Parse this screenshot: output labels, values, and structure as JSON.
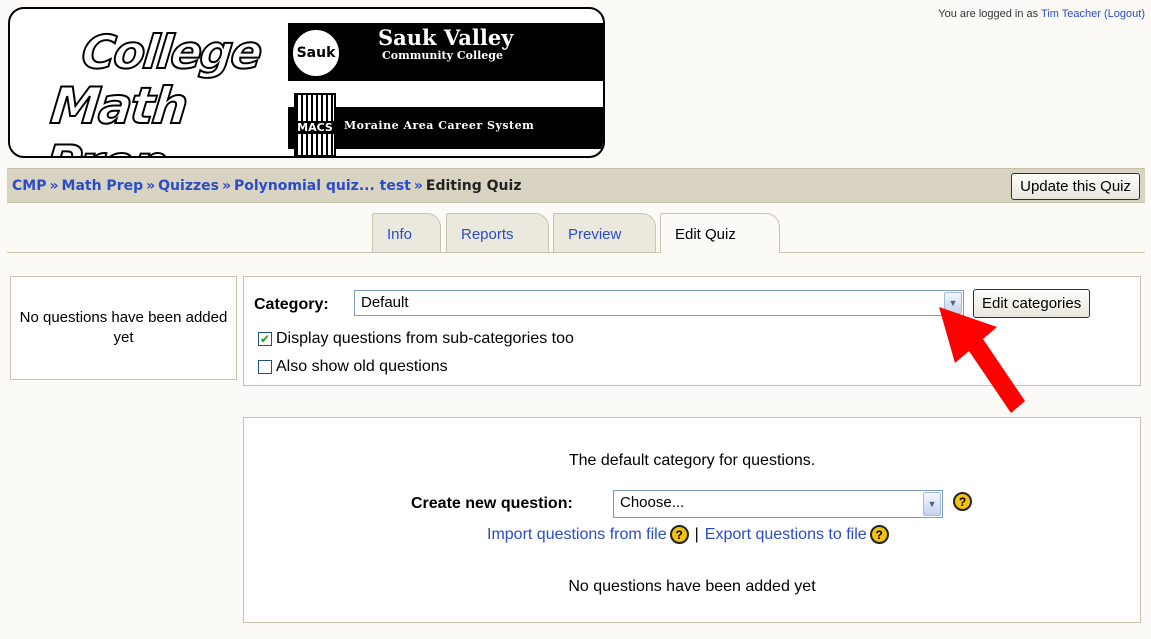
{
  "login": {
    "prefix": "You are logged in as ",
    "user": "Tim Teacher",
    "logout": "(Logout)"
  },
  "logo": {
    "line1": "College",
    "line2": "Math Prep",
    "sauk_circle": "Sauk",
    "sauk_title": "Sauk Valley",
    "sauk_subtitle": "Community College",
    "macs_short": "MACS",
    "macs_full": "Moraine Area Career System"
  },
  "breadcrumb": {
    "items": [
      "CMP",
      "Math Prep",
      "Quizzes",
      "Polynomial quiz... test"
    ],
    "separator": "»",
    "current": "Editing Quiz"
  },
  "update_button": "Update this Quiz",
  "tabs": [
    {
      "label": "Info"
    },
    {
      "label": "Reports"
    },
    {
      "label": "Preview"
    },
    {
      "label": "Edit Quiz"
    }
  ],
  "left_panel": {
    "text": "No questions have been added yet"
  },
  "category": {
    "label": "Category:",
    "selected": "Default",
    "edit_button": "Edit categories",
    "subcat_checkbox": {
      "label": "Display questions from sub-categories too",
      "checked": true
    },
    "old_checkbox": {
      "label": "Also show old questions",
      "checked": false
    }
  },
  "main": {
    "category_description": "The default category for questions.",
    "create_label": "Create new question:",
    "create_selected": "Choose...",
    "import_link": "Import questions from file",
    "pipe": "|",
    "export_link": "Export questions to file",
    "empty_message": "No questions have been added yet"
  },
  "icons": {
    "help": "question-mark-icon",
    "dropdown": "chevron-down-icon",
    "annotation": "red-arrow"
  },
  "colors": {
    "link": "#2a4cc8",
    "nav_bg": "#d9d4c2",
    "arrow": "#ff0000",
    "help": "#f4c10f"
  }
}
